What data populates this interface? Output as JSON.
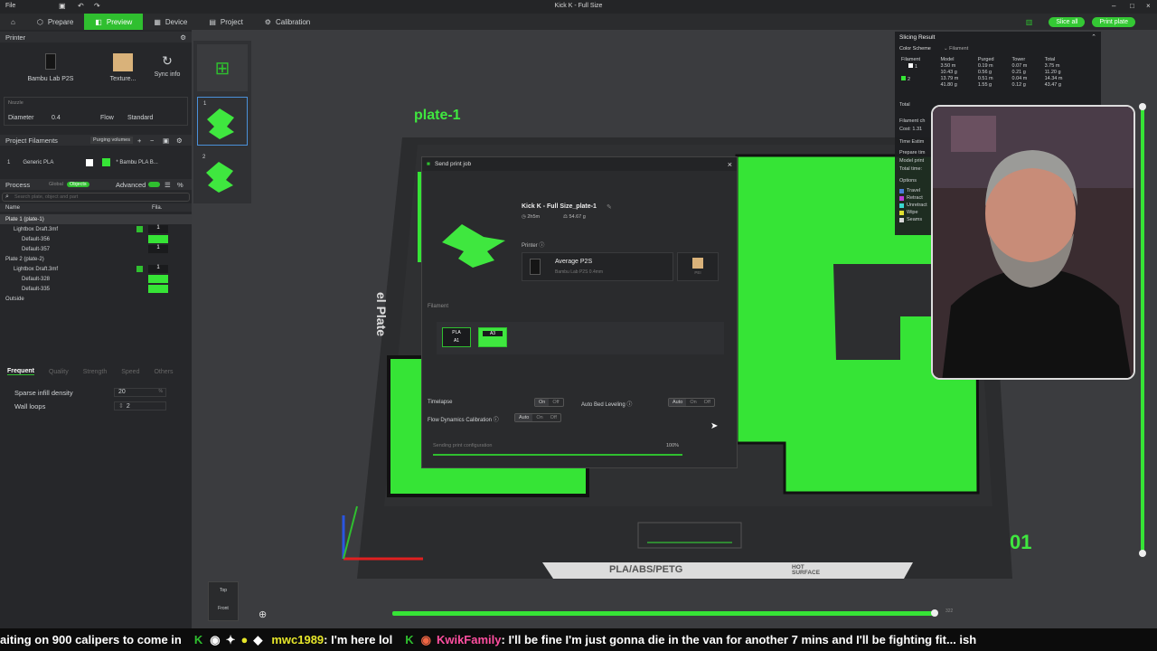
{
  "titlebar": {
    "file_menu": "File",
    "title": "Kick K - Full Size"
  },
  "menu": {
    "tabs": [
      "Prepare",
      "Preview",
      "Device",
      "Project",
      "Calibration"
    ],
    "active_tab": "Preview",
    "slice_all": "Slice all",
    "print_plate": "Print plate"
  },
  "printer": {
    "section": "Printer",
    "name": "Bambu Lab P2S",
    "plate_type": "Texture...",
    "sync": "Sync info",
    "nozzle_label": "Nozzle",
    "diameter_label": "Diameter",
    "diameter_value": "0.4",
    "flow_label": "Flow",
    "flow_value": "Standard"
  },
  "filaments": {
    "section": "Project Filaments",
    "purging": "Purging volumes",
    "items": [
      {
        "num": "1",
        "name": "Generic PLA"
      },
      {
        "num": "2",
        "name": "* Bambu PLA B..."
      }
    ]
  },
  "process": {
    "section": "Process",
    "global": "Global",
    "objects": "Objects",
    "advanced": "Advanced",
    "search_placeholder": "Search plate, object and part",
    "col_name": "Name",
    "col_fila": "Fila."
  },
  "tree": [
    {
      "label": "Plate 1 (plate-1)",
      "fila": "",
      "level": 0
    },
    {
      "label": "Lightbox Draft.3mf",
      "fila": "1",
      "level": 1
    },
    {
      "label": "Default-356",
      "fila": "",
      "level": 2
    },
    {
      "label": "Default-357",
      "fila": "1",
      "level": 2
    },
    {
      "label": "Plate 2 (plate-2)",
      "fila": "",
      "level": 0
    },
    {
      "label": "Lightbox Draft.3mf",
      "fila": "1",
      "level": 1
    },
    {
      "label": "Default-328",
      "fila": "",
      "level": 2
    },
    {
      "label": "Default-335",
      "fila": "",
      "level": 2
    },
    {
      "label": "Outside",
      "fila": "",
      "level": 0
    }
  ],
  "settings_tabs": [
    "Frequent",
    "Quality",
    "Strength",
    "Speed",
    "Others"
  ],
  "settings": [
    {
      "label": "Sparse infill density",
      "value": "20",
      "unit": "%"
    },
    {
      "label": "Wall loops",
      "value": "2",
      "unit": ""
    }
  ],
  "viewport": {
    "plate_label": "plate-1",
    "plate_text": "el Plate",
    "plate_number": "01",
    "bed_label": "PLA/ABS/PETG",
    "hot_surface": "HOT SURFACE",
    "view_top": "Top",
    "view_front": "Front",
    "layer_max": "322"
  },
  "thumbs": [
    {
      "num": "1"
    },
    {
      "num": "2"
    }
  ],
  "dialog": {
    "title": "Send print job",
    "job_name": "Kick K - Full Size_plate-1",
    "time": "2h5m",
    "weight": "54.67 g",
    "printer_label": "Printer",
    "printer_name": "Average P2S",
    "printer_model": "Bambu Lab P2S  0.4mm",
    "plate_code": "PEI",
    "filament_label": "Filament",
    "slots": [
      {
        "type": "PLA",
        "id": "A1"
      },
      {
        "type": "",
        "id": "A3"
      }
    ],
    "timelapse": "Timelapse",
    "auto_bed": "Auto Bed Leveling",
    "flow_cal": "Flow Dynamics Calibration",
    "on": "On",
    "off": "Off",
    "auto": "Auto",
    "status": "Sending print configuration",
    "percent": "100%",
    "progress": 1.0
  },
  "slicing": {
    "title": "Slicing Result",
    "color_scheme_label": "Color Scheme",
    "color_scheme_value": "Filament",
    "headers": [
      "Filament",
      "Model",
      "Purged",
      "Tower",
      "Total"
    ],
    "rows": [
      {
        "id": "1",
        "model": [
          "3.50 m",
          "10.43 g"
        ],
        "purged": [
          "0.19 m",
          "0.56 g"
        ],
        "tower": [
          "0.07 m",
          "0.21 g"
        ],
        "total": [
          "3.75 m",
          "11.20 g"
        ]
      },
      {
        "id": "2",
        "model": [
          "13.79 m",
          "41.80 g"
        ],
        "purged": [
          "0.51 m",
          "1.55 g"
        ],
        "tower": [
          "0.04 m",
          "0.12 g"
        ],
        "total": [
          "14.34 m",
          "43.47 g"
        ]
      }
    ],
    "total_label": "Total",
    "filament_ch": "Filament ch",
    "cost": "Cost: 1.31",
    "time_est": "Time Estim",
    "prepare": "Prepare tim",
    "model_print": "Model print",
    "total_time": "Total time:",
    "options_label": "Options",
    "options": [
      {
        "name": "Travel",
        "color": "#4a7bd8"
      },
      {
        "name": "Retract",
        "color": "#c03bd8"
      },
      {
        "name": "Unretract",
        "color": "#3bd8d0"
      },
      {
        "name": "Wipe",
        "color": "#e0e030"
      },
      {
        "name": "Seams",
        "color": "#d8d8d8"
      }
    ]
  },
  "ticker": {
    "lead": "aiting on 900 calipers to come in",
    "user1": "mwc1989",
    "msg1": ": I'm here lol",
    "user2": "KwikFamily",
    "msg2": ": I'll be fine I'm just gonna die in the van for another 7 mins and I'll be fighting fit... ish"
  },
  "colors": {
    "accent": "#2fbf2f",
    "plate_green": "#3fe73f",
    "user1": "#e6e62a",
    "user2": "#ff4fa0"
  }
}
